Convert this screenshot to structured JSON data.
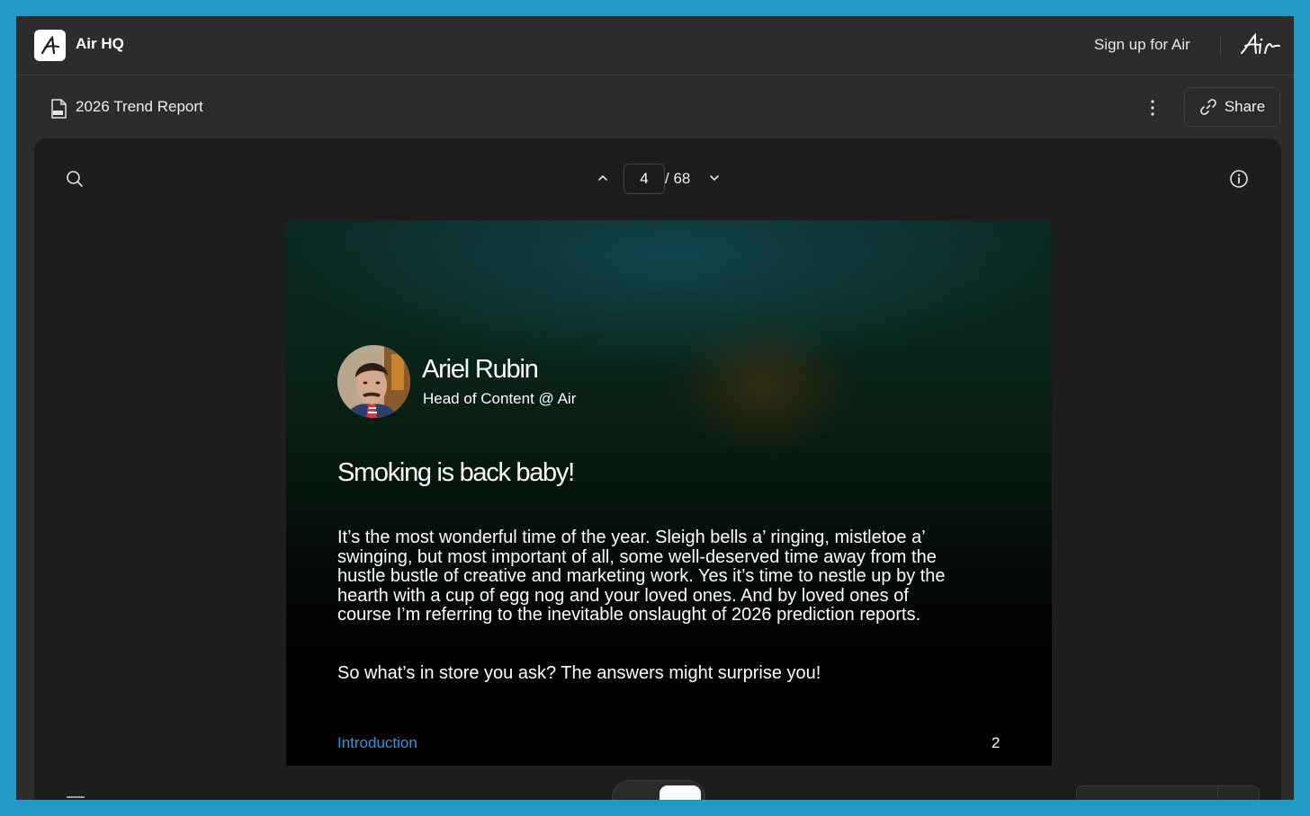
{
  "topbar": {
    "brand_name": "Air HQ",
    "signup_label": "Sign up for Air",
    "wordmark": "Air"
  },
  "docbar": {
    "title": "2026 Trend Report",
    "share_label": "Share"
  },
  "viewer": {
    "current_page": "4",
    "total_pages": "/ 68"
  },
  "page": {
    "author_name": "Ariel Rubin",
    "author_role": "Head of Content @ Air",
    "headline": "Smoking is back baby!",
    "body_paragraph_1": "It’s the most wonderful time of the year. Sleigh bells a’ ringing, mistletoe a’ swinging, but most important of all, some well-deserved time away from the hustle bustle of creative and marketing work. Yes it’s time to nestle up by the hearth with a cup of egg nog and your loved ones. And by loved ones of course I’m referring to the inevitable onslaught of 2026 prediction reports.",
    "body_paragraph_2": "So what’s in store you ask? The answers might surprise you!",
    "footer_link": "Introduction",
    "page_number": "2"
  },
  "colors": {
    "frame": "#2298c4",
    "app_bg": "#2c2c2c",
    "viewer_bg": "#1d1d1d",
    "link": "#1e9bf0"
  }
}
